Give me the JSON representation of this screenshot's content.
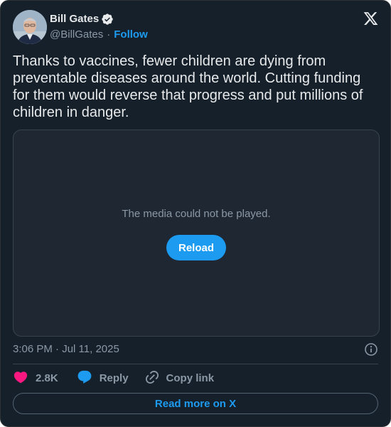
{
  "author": {
    "name": "Bill Gates",
    "handle": "@BillGates",
    "separator": "·",
    "follow_label": "Follow",
    "verified": true
  },
  "tweet": {
    "text": "Thanks to vaccines, fewer children are dying from preventable diseases around the world. Cutting funding for them would reverse that progress and put millions of children in danger."
  },
  "media": {
    "message": "The media could not be played.",
    "reload_label": "Reload"
  },
  "meta": {
    "timestamp": "3:06 PM · Jul 11, 2025"
  },
  "actions": {
    "like_count": "2.8K",
    "reply_label": "Reply",
    "copy_link_label": "Copy link"
  },
  "footer": {
    "read_more_label": "Read more on X"
  },
  "colors": {
    "background": "#15202b",
    "accent": "#1d9bf0",
    "like": "#f91880",
    "text_primary": "#e7e9ea",
    "text_secondary": "#8b98a5"
  },
  "icons": [
    "avatar",
    "verified-badge-icon",
    "x-logo-icon",
    "info-icon",
    "heart-icon",
    "reply-bubble-icon",
    "link-icon"
  ]
}
